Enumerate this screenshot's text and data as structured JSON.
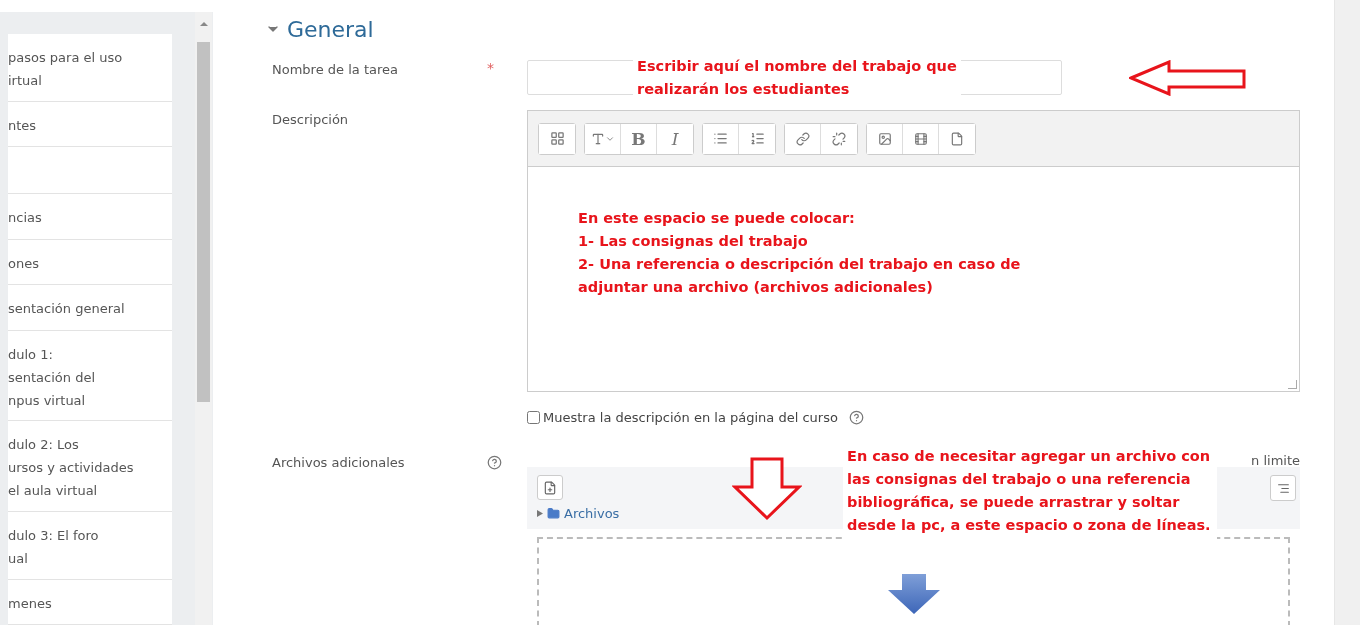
{
  "sidebar": {
    "items": [
      {
        "kind": "text",
        "lines": [
          "pasos para el uso",
          "irtual"
        ]
      },
      {
        "kind": "text",
        "lines": [
          "ntes"
        ]
      },
      {
        "kind": "empty"
      },
      {
        "kind": "text",
        "lines": [
          "ncias"
        ]
      },
      {
        "kind": "text",
        "lines": [
          "ones"
        ]
      },
      {
        "kind": "text",
        "lines": [
          "sentación general"
        ]
      },
      {
        "kind": "text",
        "lines": [
          "dulo 1:",
          "sentación del",
          "npus virtual"
        ]
      },
      {
        "kind": "text",
        "lines": [
          "dulo 2: Los",
          "ursos y actividades",
          "el aula virtual"
        ]
      },
      {
        "kind": "text",
        "lines": [
          "dulo 3: El foro",
          "ual"
        ]
      },
      {
        "kind": "text",
        "lines": [
          "menes"
        ]
      }
    ]
  },
  "section": {
    "title": "General",
    "expanded": true
  },
  "name_field": {
    "label": "Nombre de la tarea",
    "required_mark": "*",
    "annotation": [
      "Escribir aquí el nombre del trabajo que",
      "realizarán los estudiantes"
    ]
  },
  "description": {
    "label": "Descripción",
    "toolbar": [
      [
        {
          "kind": "block"
        }
      ],
      [
        {
          "kind": "style"
        },
        {
          "kind": "bold",
          "label": "B"
        },
        {
          "kind": "italic",
          "label": "I"
        }
      ],
      [
        {
          "kind": "ul"
        },
        {
          "kind": "ol"
        }
      ],
      [
        {
          "kind": "link"
        },
        {
          "kind": "unlink"
        }
      ],
      [
        {
          "kind": "image"
        },
        {
          "kind": "media"
        },
        {
          "kind": "files"
        }
      ]
    ],
    "annotation": [
      "En este espacio se puede colocar:",
      "1- Las consignas del trabajo",
      "2- Una referencia o descripción del trabajo en caso de",
      "adjuntar una archivo (archivos adicionales)"
    ]
  },
  "show_description": {
    "label": "Muestra la descripción en la página del curso",
    "checked": false
  },
  "files": {
    "label": "Archivos adicionales",
    "limit": "n limite",
    "folder": "Archivos",
    "annotation": [
      "En caso de necesitar agregar un archivo con",
      "las consignas del trabajo o una referencia",
      "bibliográfica, se puede arrastrar y soltar",
      "desde la pc, a este espacio o zona de líneas."
    ]
  }
}
